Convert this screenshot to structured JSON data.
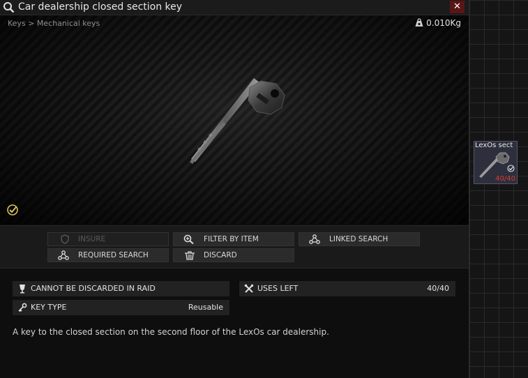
{
  "window": {
    "title": "Car dealership closed section key",
    "close_glyph": "✕",
    "breadcrumb": "Keys > Mechanical keys",
    "weight": "0.010Kg"
  },
  "actions": {
    "insure": "INSURE",
    "filter_by_item": "FILTER BY ITEM",
    "linked_search": "LINKED SEARCH",
    "required_search": "REQUIRED SEARCH",
    "discard": "DISCARD"
  },
  "stats": {
    "cannot_discard": "CANNOT BE DISCARDED IN RAID",
    "uses_left_label": "USES LEFT",
    "uses_left_value": "40/40",
    "key_type_label": "KEY TYPE",
    "key_type_value": "Reusable"
  },
  "description": "A key to the closed section on the second floor of the LexOs car dealership.",
  "stash_item": {
    "name": "LexOs sect",
    "uses": "40/40"
  },
  "colors": {
    "close_bg": "#5a1515",
    "uses_red": "#e03a2f",
    "stash_item_bg": "#2d2f3d"
  },
  "icons": {
    "search": "magnifier-icon",
    "weight": "weight-icon",
    "examined": "checkmark-badge-icon",
    "insure": "shield-icon",
    "filter": "magnifier-plus-icon",
    "linked": "nodes-icon",
    "required": "nodes-icon",
    "discard": "trash-icon",
    "cannot_discard": "cup-icon",
    "uses": "tools-icon",
    "key_type": "key-icon"
  }
}
